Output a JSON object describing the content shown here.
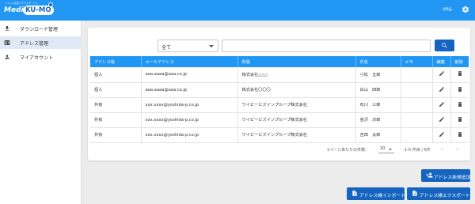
{
  "header": {
    "logo_tagline": "ファイル転送クラウドサービス",
    "logo_media": "Media",
    "logo_kumo": "KU-MO",
    "user": "YPG",
    "settings_icon": "gear-icon",
    "accent": "#2196f3"
  },
  "sidebar": {
    "items": [
      {
        "label": "ダウンロード管理",
        "icon": "download-icon"
      },
      {
        "label": "アドレス管理",
        "icon": "contact-card-icon",
        "active": true
      },
      {
        "label": "マイアカウント",
        "icon": "person-icon"
      }
    ]
  },
  "filter": {
    "select_value": "全て",
    "search_value": ""
  },
  "table": {
    "headers": [
      "アドレス帳",
      "メールアドレス",
      "所属",
      "氏名",
      "メモ",
      "編集",
      "削除"
    ],
    "rows": [
      {
        "book": "個人",
        "email": "aaa.aaaa@aaa.co.jp",
        "org": "株式会社△△△",
        "name": "小松　五郎",
        "memo": ""
      },
      {
        "book": "個人",
        "email": "aaa.aaaa@aaa.co.jp",
        "org": "株式会社〇〇〇",
        "name": "白山　四郎",
        "memo": ""
      },
      {
        "book": "共有",
        "email": "xxx.xxxx@yoshida-p.co.jp",
        "org": "ワイピービズインプループ株式会社",
        "name": "石川　三郎",
        "memo": ""
      },
      {
        "book": "共有",
        "email": "xxx.xxxx@yoshida-p.co.jp",
        "org": "ワイピービズインプループ株式会社",
        "name": "金沢　次郎",
        "memo": ""
      },
      {
        "book": "共有",
        "email": "xxx.xxxx@yoshida-p.co.jp",
        "org": "ワイピービズインプループ株式会社",
        "name": "吉田　太郎",
        "memo": ""
      }
    ]
  },
  "pagination": {
    "per_page_label": "1ページあたりの件数：",
    "per_page": "10",
    "range": "1-5 件目 / 5件",
    "prev": "‹",
    "next": "›"
  },
  "actions": {
    "add": "アドレス新規追加",
    "import": "アドレス帳インポート",
    "export": "アドレス帳エクスポート"
  }
}
